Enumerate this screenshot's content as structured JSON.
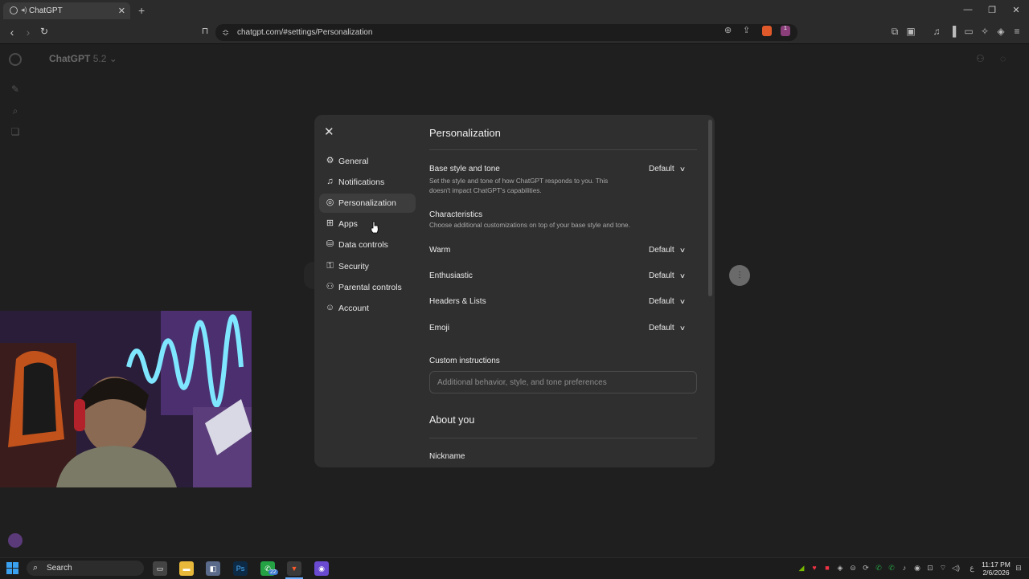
{
  "browser": {
    "tab_title": "ChatGPT",
    "url": "chatgpt.com/#settings/Personalization",
    "badge_count": "1"
  },
  "app": {
    "title": "ChatGPT",
    "version": "5.2"
  },
  "settings": {
    "nav": [
      {
        "label": "General",
        "icon": "gear-icon"
      },
      {
        "label": "Notifications",
        "icon": "bell-icon"
      },
      {
        "label": "Personalization",
        "icon": "personalization-icon"
      },
      {
        "label": "Apps",
        "icon": "apps-grid-icon"
      },
      {
        "label": "Data controls",
        "icon": "database-icon"
      },
      {
        "label": "Security",
        "icon": "shield-key-icon"
      },
      {
        "label": "Parental controls",
        "icon": "users-icon"
      },
      {
        "label": "Account",
        "icon": "user-circle-icon"
      }
    ],
    "active_nav": "Personalization",
    "page_title": "Personalization",
    "base_style": {
      "title": "Base style and tone",
      "subtitle_line1": "Set the style and tone of how ChatGPT responds to you. This",
      "subtitle_line2": "doesn't impact ChatGPT's capabilities.",
      "value": "Default"
    },
    "characteristics": {
      "title": "Characteristics",
      "subtitle": "Choose additional customizations on top of your base style and tone.",
      "items": [
        {
          "label": "Warm",
          "value": "Default"
        },
        {
          "label": "Enthusiastic",
          "value": "Default"
        },
        {
          "label": "Headers & Lists",
          "value": "Default"
        },
        {
          "label": "Emoji",
          "value": "Default"
        }
      ]
    },
    "custom_instructions": {
      "title": "Custom instructions",
      "placeholder": "Additional behavior, style, and tone preferences"
    },
    "about_you": {
      "title": "About you",
      "nickname_label": "Nickname"
    }
  },
  "taskbar": {
    "search_label": "Search",
    "whatsapp_badge": "22",
    "time": "11:17 PM",
    "date": "2/6/2026"
  }
}
